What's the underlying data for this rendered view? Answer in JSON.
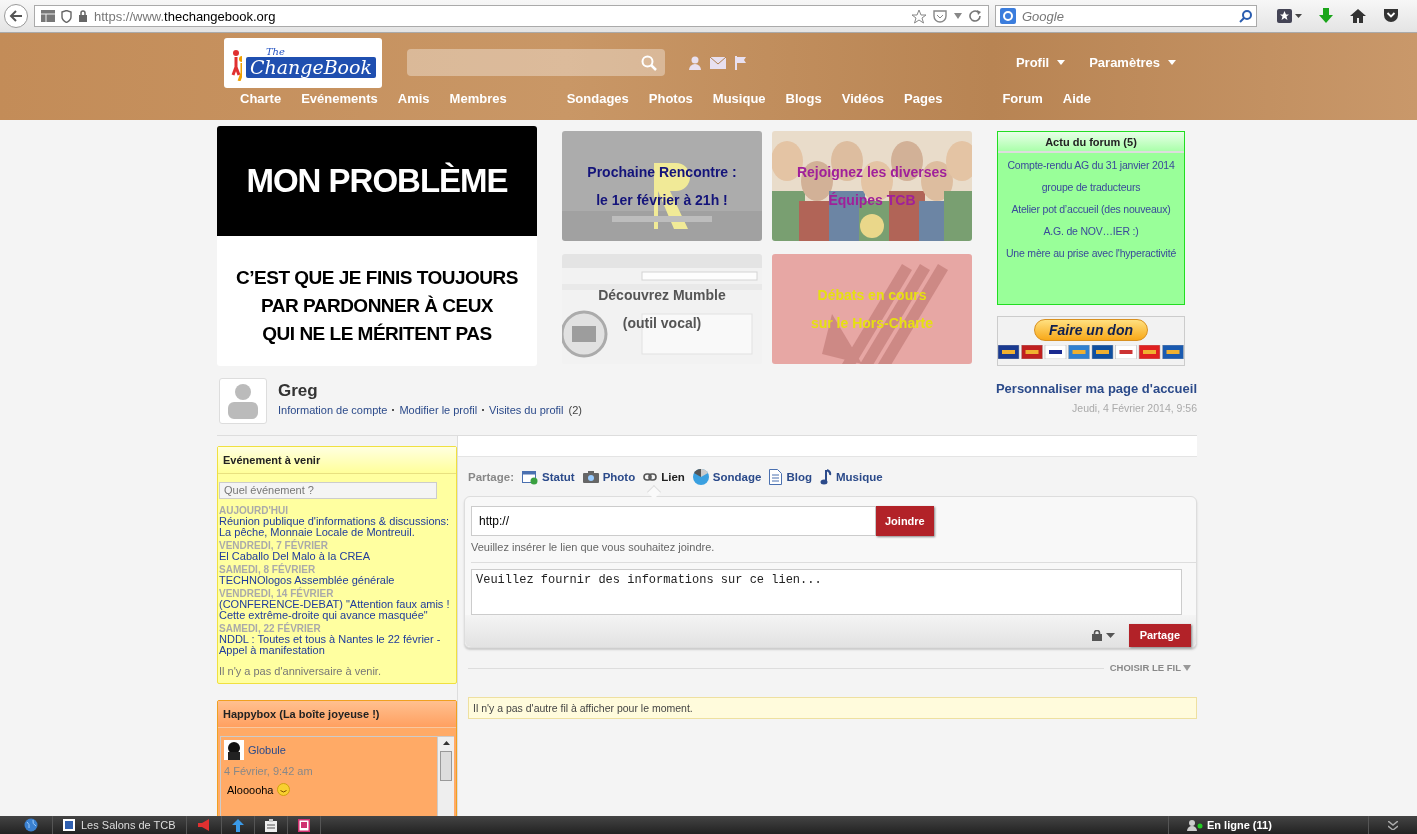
{
  "browser": {
    "url_prefix": "https://www.",
    "url_domain": "thechangebook.org",
    "search_placeholder": "Google"
  },
  "header": {
    "logo": {
      "small": "The",
      "main": "ChangeBook"
    },
    "menus": [
      {
        "label": "Profil"
      },
      {
        "label": "Paramètres"
      }
    ],
    "nav_groups": [
      [
        "Charte",
        "Evénements",
        "Amis",
        "Membres"
      ],
      [
        "Sondages",
        "Photos",
        "Musique",
        "Blogs",
        "Vidéos",
        "Pages"
      ],
      [
        "Forum",
        "Aide"
      ]
    ]
  },
  "banners": {
    "meme": {
      "top": "MON PROBLÈME",
      "lines": [
        "C’EST QUE JE FINIS TOUJOURS",
        "PAR PARDONNER À CEUX",
        "QUI NE LE MÉRITENT PAS"
      ]
    },
    "tiles": [
      {
        "kind": "rencontre",
        "lines": [
          "Prochaine Rencontre :",
          "le 1er février à 21h !"
        ],
        "color": "#14147a"
      },
      {
        "kind": "crowd",
        "lines": [
          "Rejoignez les diverses",
          "Équipes TCB"
        ],
        "color": "#a0209a"
      },
      {
        "kind": "screenshot",
        "lines": [
          "Découvrez Mumble",
          "(outil vocal)"
        ],
        "color": "#555555"
      },
      {
        "kind": "arrows",
        "lines": [
          "Débats en cours",
          "sur le Hors-Charte"
        ],
        "color": "#e6e010"
      }
    ]
  },
  "forum": {
    "title": "Actu du forum (5)",
    "items": [
      "Compte-rendu AG du 31 janvier 2014",
      "groupe de traducteurs",
      "Atelier pot d’accueil (des nouveaux)",
      "A.G. de NOV…IER :)",
      "Une mère au prise avec l'hyperactivité"
    ]
  },
  "donate": {
    "button": "Faire un don"
  },
  "profile": {
    "name": "Greg",
    "links": [
      "Information de compte",
      "Modifier le profil",
      "Visites du profil"
    ],
    "visits": "(2)",
    "customize": "Personnaliser ma page d'accueil",
    "date": "Jeudi, 4 Février 2014, 9:56"
  },
  "events": {
    "title": "Evénement à venir",
    "search_placeholder": "Quel événement ?",
    "days": [
      {
        "date": "AUJOURD'HUI",
        "events": [
          "Réunion publique d'informations & discussions: La pêche, Monnaie Locale de Montreuil."
        ]
      },
      {
        "date": "VENDREDI, 7 FÉVRIER",
        "events": [
          "El Caballo Del Malo à la CREA"
        ]
      },
      {
        "date": "SAMEDI, 8 FÉVRIER",
        "events": [
          "TECHNOlogos Assemblée générale"
        ]
      },
      {
        "date": "VENDREDI, 14 FÉVRIER",
        "events": [
          "(CONFERENCE-DEBAT) \"Attention faux amis ! Cette extrême-droite qui avance masquée\""
        ]
      },
      {
        "date": "SAMEDI, 22 FÉVRIER",
        "events": [
          "NDDL : Toutes et tous à Nantes le 22 février - Appel à manifestation"
        ]
      }
    ],
    "note": "Il n'y a pas d'anniversaire à venir."
  },
  "happybox": {
    "title": "Happybox (La boîte joyeuse !)",
    "messages": [
      {
        "author": "Globule",
        "time": "4 Février, 9:42 am",
        "text": "Alooooha"
      }
    ]
  },
  "share": {
    "label": "Partage:",
    "tabs": [
      {
        "kind": "status",
        "label": "Statut",
        "selected": false
      },
      {
        "label": "Photo",
        "selected": false
      },
      {
        "kind": "link",
        "label": "Lien",
        "selected": true
      },
      {
        "kind": "poll",
        "label": "Sondage",
        "selected": false
      },
      {
        "kind": "blog",
        "label": "Blog",
        "selected": false
      },
      {
        "kind": "music",
        "label": "Musique",
        "selected": false
      }
    ],
    "link_value": "http://",
    "attach_button": "Joindre",
    "hint": "Veuillez insérer le lien que vous souhaitez joindre.",
    "description_placeholder": "Veuillez fournir des informations sur ce lien...",
    "submit_button": "Partage",
    "feed_filter": "CHOISIR LE FIL",
    "empty": "Il n'y a pas d'autre fil à afficher pour le moment."
  },
  "taskbar": {
    "items": [
      {
        "label": "Les Salons de TCB"
      }
    ],
    "online": "En ligne (11)"
  }
}
